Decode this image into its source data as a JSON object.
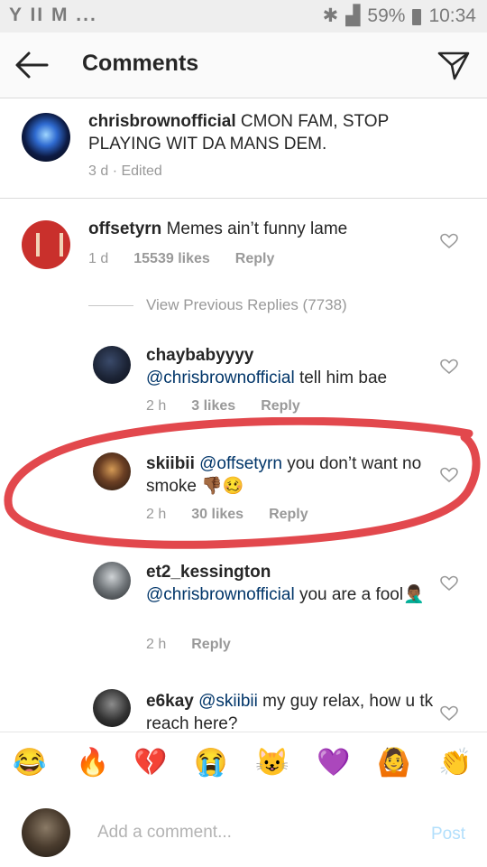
{
  "status": {
    "left_icons": "Y II M ...",
    "battery": "59%",
    "time": "10:34"
  },
  "header": {
    "title": "Comments"
  },
  "caption": {
    "username": "chrisbrownofficial",
    "text": "CMON FAM, STOP PLAYING WIT DA MANS DEM.",
    "meta": "3 d · Edited"
  },
  "comments": [
    {
      "username": "offsetyrn",
      "text": "Memes ain’t funny lame",
      "time": "1 d",
      "likes": "15539 likes",
      "reply": "Reply"
    }
  ],
  "view_previous": "View Previous Replies (7738)",
  "replies": [
    {
      "username": "chaybabyyyy",
      "mention": "@chrisbrownofficial",
      "text": "tell him bae",
      "time": "2 h",
      "likes": "3 likes",
      "reply": "Reply"
    },
    {
      "username": "skiibii",
      "mention": "@offsetyrn",
      "text": "you don’t want no smoke 👎🏾🥴",
      "time": "2 h",
      "likes": "30 likes",
      "reply": "Reply"
    },
    {
      "username": "et2_kessington",
      "mention": "@chrisbrownofficial",
      "text": "you are a fool🤦🏾‍♂️",
      "time": "2 h",
      "reply": "Reply"
    },
    {
      "username": "e6kay",
      "mention": "@skiibii",
      "text": "my guy relax, how u tk reach here?"
    }
  ],
  "emoji_bar": [
    "😂",
    "🔥",
    "💔",
    "😭",
    "😺",
    "💜",
    "🙆",
    "👏"
  ],
  "composer": {
    "placeholder": "Add a comment...",
    "post": "Post"
  },
  "colors": {
    "mention": "#003569",
    "post_disabled": "#b2dffc",
    "annotation": "#e0383e"
  }
}
